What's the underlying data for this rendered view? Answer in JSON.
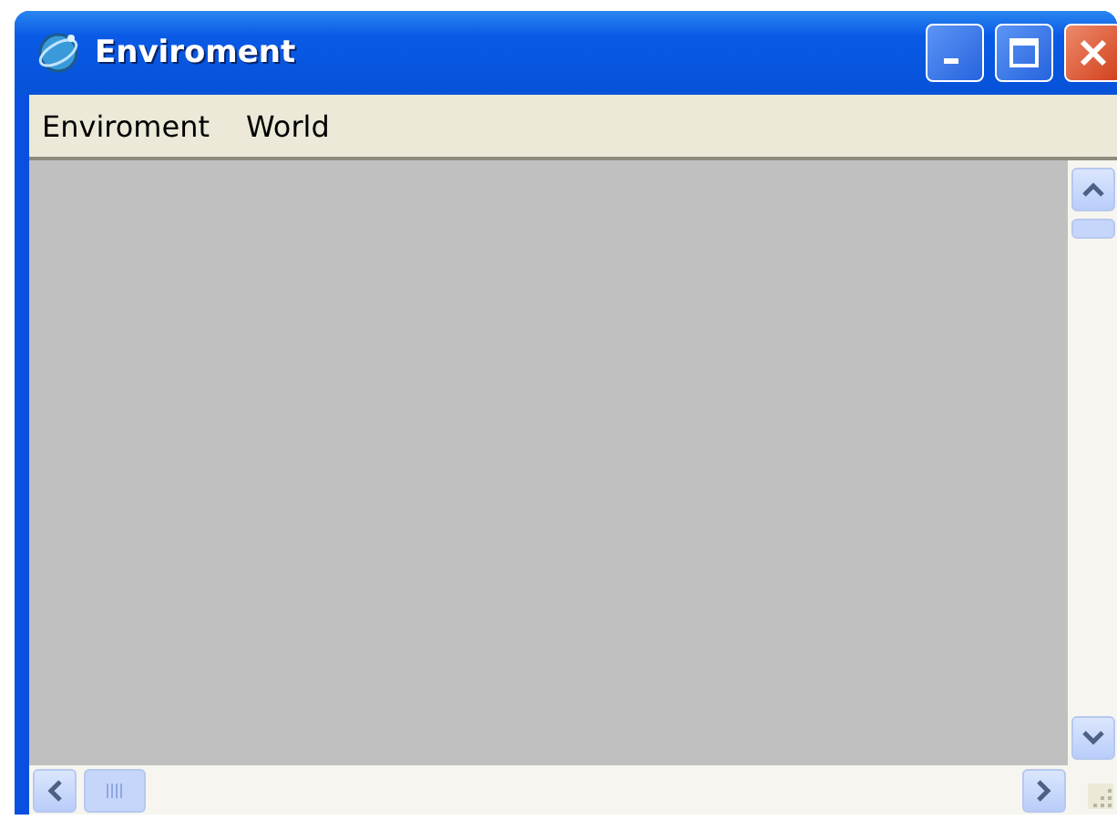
{
  "window": {
    "title": "Enviroment"
  },
  "menu": [
    {
      "label": "Enviroment"
    },
    {
      "label": "World"
    }
  ]
}
